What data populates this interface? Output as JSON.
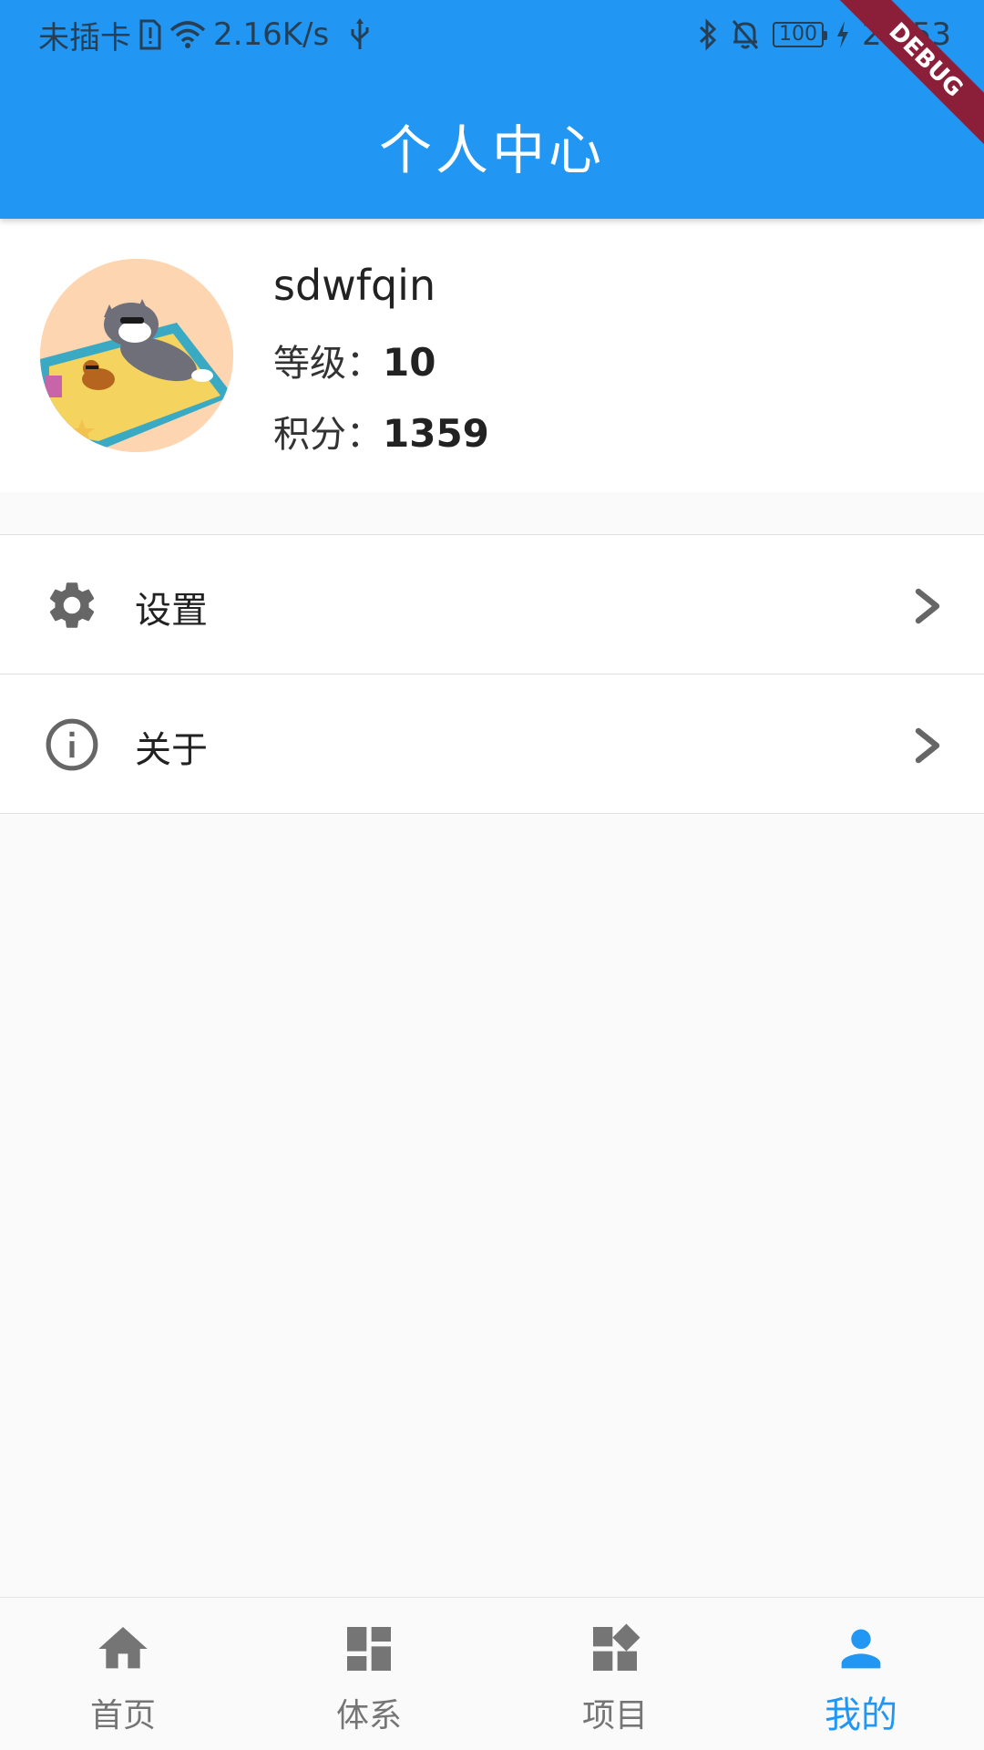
{
  "status_bar": {
    "carrier": "未插卡",
    "speed": "2.16K/s",
    "battery": "100",
    "time": "20:53"
  },
  "app_bar": {
    "title": "个人中心",
    "debug_banner": "DEBUG"
  },
  "profile": {
    "username": "sdwfqin",
    "level_label": "等级：",
    "level_value": "10",
    "points_label": "积分：",
    "points_value": "1359",
    "avatar_icon": "avatar-image"
  },
  "menu": {
    "items": [
      {
        "label": "设置",
        "icon": "gear-icon"
      },
      {
        "label": "关于",
        "icon": "info-icon"
      }
    ]
  },
  "bottom_nav": {
    "items": [
      {
        "label": "首页",
        "icon": "home-icon",
        "active": false
      },
      {
        "label": "体系",
        "icon": "dashboard-icon",
        "active": false
      },
      {
        "label": "项目",
        "icon": "widgets-icon",
        "active": false
      },
      {
        "label": "我的",
        "icon": "person-icon",
        "active": true
      }
    ],
    "active_color": "#2196f3",
    "inactive_color": "#757575"
  },
  "colors": {
    "primary": "#2196f3",
    "background": "#fafafa"
  }
}
